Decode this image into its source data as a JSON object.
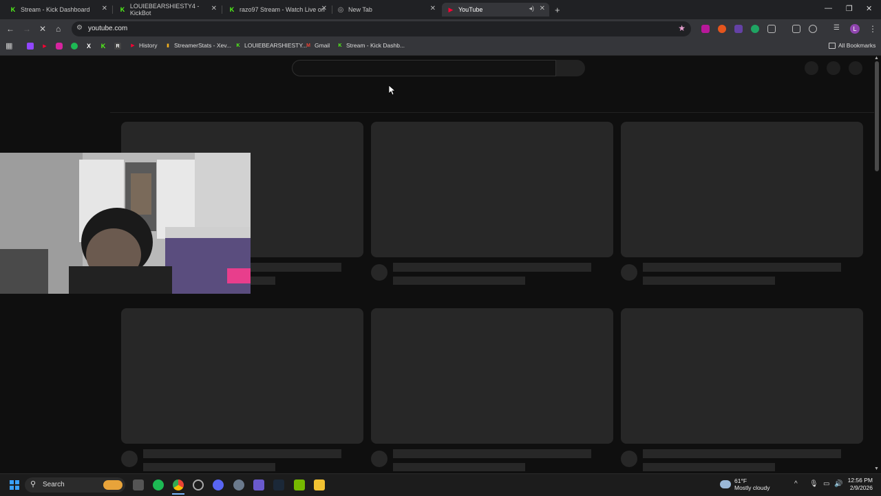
{
  "browser": {
    "tabs": [
      {
        "label": "Stream - Kick Dashboard",
        "favicon": "kick-icon",
        "color": "#53fc18"
      },
      {
        "label": "LOUIEBEARSHIESTY4 - KickBot",
        "favicon": "kick-icon",
        "color": "#53fc18"
      },
      {
        "label": "razo97 Stream - Watch Live on",
        "favicon": "kick-icon",
        "color": "#53fc18"
      },
      {
        "label": "New Tab",
        "favicon": "chrome-icon",
        "color": "#aaaaaa"
      },
      {
        "label": "YouTube",
        "favicon": "youtube-icon",
        "color": "#ff0033",
        "active": true
      }
    ],
    "new_tab_symbol": "+",
    "url": "youtube.com",
    "bookmarks": [
      {
        "label": "History",
        "icon": "youtube-icon"
      },
      {
        "label": "StreamerStats - Xev...",
        "icon": "chart-icon"
      },
      {
        "label": "LOUIEBEARSHIESTY...",
        "icon": "kick-icon"
      },
      {
        "label": "Gmail",
        "icon": "gmail-icon"
      },
      {
        "label": "Stream - Kick Dashb...",
        "icon": "kick-icon"
      }
    ],
    "all_bookmarks_label": "All Bookmarks",
    "profile_initial": "L"
  },
  "taskbar": {
    "search_label": "Search",
    "weather_temp": "61°F",
    "weather_desc": "Mostly cloudy",
    "time": "12:56 PM",
    "date": "2/9/2026"
  },
  "colors": {
    "page_bg": "#0f0f0f",
    "skeleton": "#272727",
    "kick_green": "#53fc18",
    "youtube_red": "#ff0033"
  }
}
